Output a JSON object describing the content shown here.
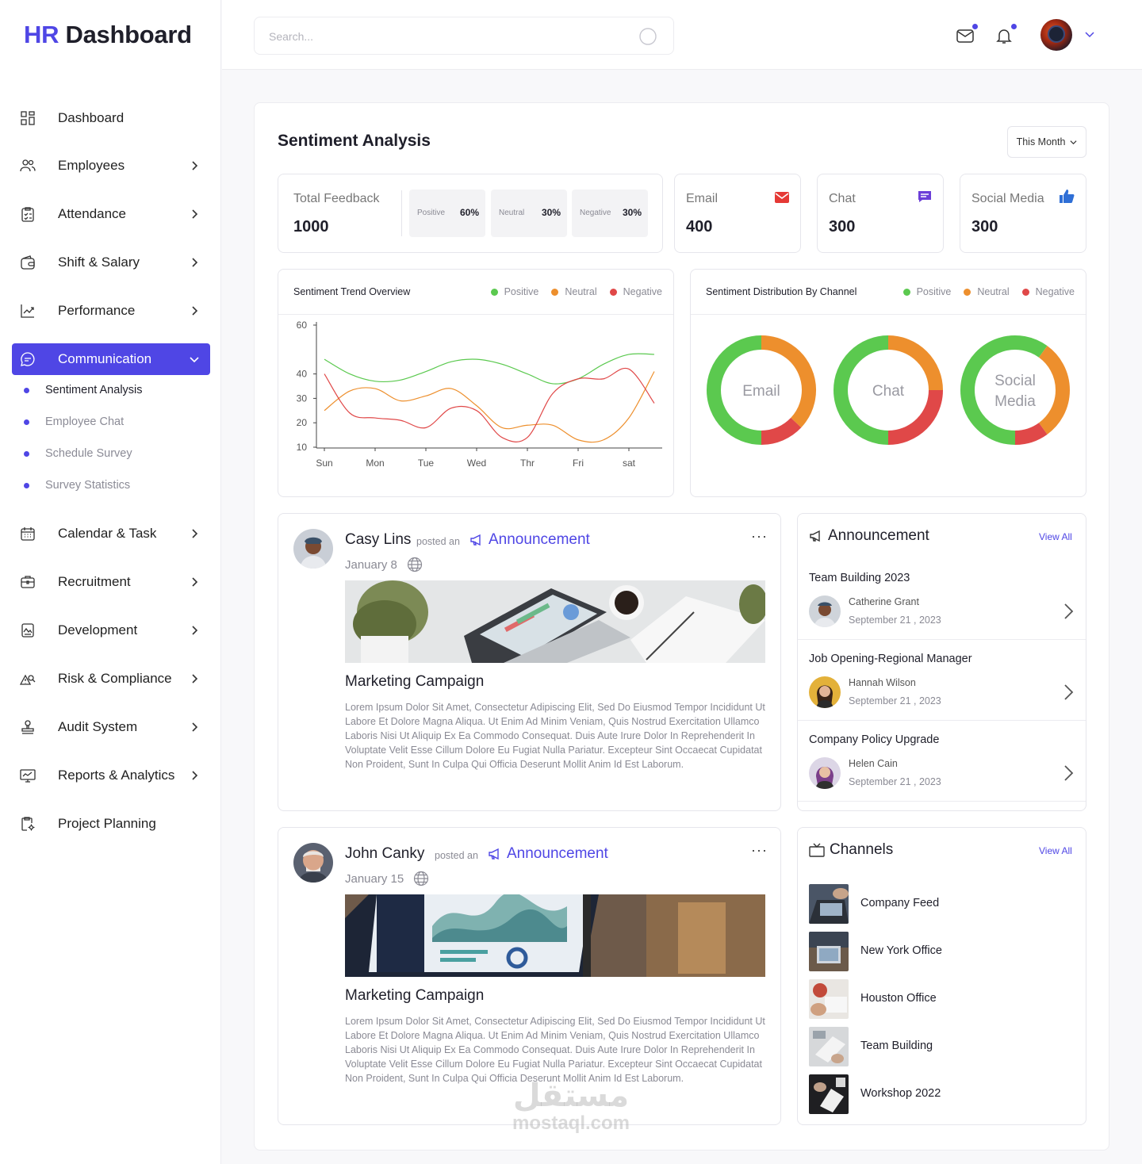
{
  "logo": {
    "hr": "HR",
    "dashboard": "Dashboard"
  },
  "search": {
    "placeholder": "Search..."
  },
  "sidebar": {
    "items": [
      {
        "label": "Dashboard",
        "icon": "grid-icon",
        "has_chevron": false
      },
      {
        "label": "Employees",
        "icon": "users-icon",
        "has_chevron": true
      },
      {
        "label": "Attendance",
        "icon": "checklist-icon",
        "has_chevron": true
      },
      {
        "label": "Shift & Salary",
        "icon": "wallet-icon",
        "has_chevron": true
      },
      {
        "label": "Performance",
        "icon": "trend-icon",
        "has_chevron": true
      },
      {
        "label": "Communication",
        "icon": "chat-icon",
        "has_chevron": true,
        "active": true
      },
      {
        "label": "Calendar & Task",
        "icon": "calendar-icon",
        "has_chevron": true
      },
      {
        "label": "Recruitment",
        "icon": "briefcase-icon",
        "has_chevron": true
      },
      {
        "label": "Development",
        "icon": "doc-chart-icon",
        "has_chevron": true
      },
      {
        "label": "Risk & Compliance",
        "icon": "risk-icon",
        "has_chevron": true
      },
      {
        "label": "Audit System",
        "icon": "stamp-icon",
        "has_chevron": true
      },
      {
        "label": "Reports & Analytics",
        "icon": "monitor-chart-icon",
        "has_chevron": true
      },
      {
        "label": "Project Planning",
        "icon": "clipboard-gear-icon",
        "has_chevron": false
      }
    ],
    "sub_items": [
      {
        "label": "Sentiment Analysis",
        "current": true
      },
      {
        "label": "Employee Chat"
      },
      {
        "label": "Schedule Survey"
      },
      {
        "label": "Survey Statistics"
      }
    ]
  },
  "page": {
    "title": "Sentiment Analysis",
    "period": "This Month"
  },
  "stats": {
    "total": {
      "label": "Total Feedback",
      "value": "1000"
    },
    "breakdown": [
      {
        "label": "Positive",
        "value": "60%"
      },
      {
        "label": "Neutral",
        "value": "30%"
      },
      {
        "label": "Negative",
        "value": "30%"
      }
    ],
    "channels": [
      {
        "label": "Email",
        "value": "400",
        "icon": "mail-icon",
        "color": "#e53935"
      },
      {
        "label": "Chat",
        "value": "300",
        "icon": "message-icon",
        "color": "#6c3fd8"
      },
      {
        "label": "Social Media",
        "value": "300",
        "icon": "thumbs-up-icon",
        "color": "#2f6fd6"
      }
    ]
  },
  "colors": {
    "accent": "#4f46e5",
    "positive": "#5bc94f",
    "neutral": "#ed8f2d",
    "negative": "#e04848"
  },
  "chart_data": [
    {
      "type": "line",
      "title": "Sentiment Trend Overview",
      "categories": [
        "Sun",
        "Mon",
        "Tue",
        "Wed",
        "Thr",
        "Fri",
        "sat"
      ],
      "ylim": [
        10,
        60
      ],
      "yticks": [
        10,
        20,
        30,
        40,
        60
      ],
      "legend_position": "top-right",
      "series": [
        {
          "name": "Positive",
          "color": "#5bc94f",
          "x": [
            0,
            0.5,
            1,
            1.5,
            2,
            2.5,
            3,
            3.5,
            4,
            4.5,
            5,
            5.5,
            6,
            6.5
          ],
          "values": [
            46,
            40,
            37,
            37.5,
            41,
            45,
            46,
            44,
            40,
            36,
            38,
            44,
            48,
            48
          ]
        },
        {
          "name": "Neutral",
          "color": "#ed8f2d",
          "x": [
            0,
            0.5,
            1,
            1.5,
            2,
            2.5,
            3,
            3.5,
            4,
            4.5,
            5,
            5.5,
            6,
            6.5
          ],
          "values": [
            25,
            33,
            34,
            29,
            31,
            34,
            27,
            18,
            19,
            19,
            13,
            13,
            22,
            41
          ]
        },
        {
          "name": "Negative",
          "color": "#e04848",
          "x": [
            0,
            0.5,
            1,
            1.5,
            2,
            2.5,
            3,
            3.5,
            4,
            4.5,
            5,
            5.5,
            6,
            6.5
          ],
          "values": [
            40,
            24,
            22,
            21,
            18,
            26,
            25,
            14,
            14,
            32,
            38,
            38,
            42,
            28
          ]
        }
      ]
    },
    {
      "type": "pie",
      "title": "Sentiment Distribution By Channel",
      "legend_position": "top-right",
      "series_names": [
        "Positive",
        "Neutral",
        "Negative"
      ],
      "charts": [
        {
          "label": "Email",
          "values": [
            50,
            37,
            13
          ]
        },
        {
          "label": "Chat",
          "values": [
            50,
            25,
            25
          ]
        },
        {
          "label": "Social Media",
          "values": [
            60,
            30,
            10
          ]
        }
      ]
    }
  ],
  "donut_labels": [
    {
      "lines": [
        "Email"
      ]
    },
    {
      "lines": [
        "Chat"
      ]
    },
    {
      "lines": [
        "Social",
        "Media"
      ]
    }
  ],
  "posts": [
    {
      "author": "Casy Lins",
      "posted_on": "posted an",
      "category": "Announcement",
      "date": "January 8",
      "title": "Marketing Campaign",
      "body": "Lorem Ipsum Dolor Sit Amet, Consectetur Adipiscing Elit, Sed Do Eiusmod Tempor Incididunt Ut Labore Et Dolore Magna Aliqua. Ut Enim Ad Minim Veniam, Quis Nostrud Exercitation Ullamco Laboris Nisi Ut Aliquip Ex Ea Commodo Consequat. Duis Aute Irure Dolor In Reprehenderit In Voluptate Velit Esse Cillum Dolore Eu Fugiat Nulla Pariatur. Excepteur Sint Occaecat Cupidatat Non Proident, Sunt In Culpa Qui Officia Deserunt Mollit Anim Id Est Laborum.",
      "more": "···"
    },
    {
      "author": "John Canky",
      "posted_on": "posted an",
      "category": "Announcement",
      "date": "January 15",
      "title": "Marketing Campaign",
      "body": "Lorem Ipsum Dolor Sit Amet, Consectetur Adipiscing Elit, Sed Do Eiusmod Tempor Incididunt Ut Labore Et Dolore Magna Aliqua. Ut Enim Ad Minim Veniam, Quis Nostrud Exercitation Ullamco Laboris Nisi Ut Aliquip Ex Ea Commodo Consequat. Duis Aute Irure Dolor In Reprehenderit In Voluptate Velit Esse Cillum Dolore Eu Fugiat Nulla Pariatur. Excepteur Sint Occaecat Cupidatat Non Proident, Sunt In Culpa Qui Officia Deserunt Mollit Anim Id Est Laborum.",
      "more": "···"
    }
  ],
  "announcements": {
    "title": "Announcement",
    "view_all": "View All",
    "items": [
      {
        "title": "Team Building 2023",
        "name": "Catherine Grant",
        "date": "September 21 , 2023"
      },
      {
        "title": "Job Opening-Regional Manager",
        "name": "Hannah Wilson",
        "date": "September 21 , 2023"
      },
      {
        "title": "Company Policy Upgrade",
        "name": "Helen Cain",
        "date": "September 21 , 2023"
      }
    ]
  },
  "channels": {
    "title": "Channels",
    "view_all": "View All",
    "items": [
      {
        "label": "Company Feed"
      },
      {
        "label": "New York Office"
      },
      {
        "label": "Houston Office"
      },
      {
        "label": "Team Building"
      },
      {
        "label": "Workshop 2022"
      }
    ]
  },
  "watermark": {
    "arabic": "مستقل",
    "latin": "mostaql.com"
  }
}
